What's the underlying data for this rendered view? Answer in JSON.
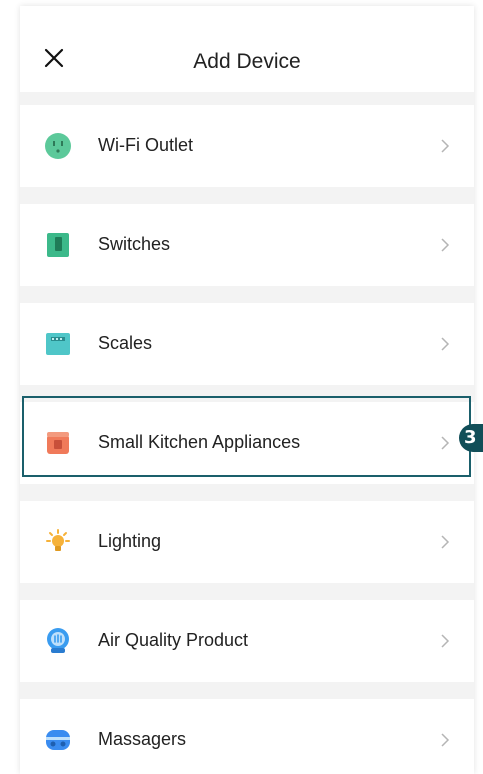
{
  "header": {
    "title": "Add Device"
  },
  "devices": [
    {
      "label": "Wi-Fi Outlet",
      "icon": "outlet-icon",
      "color": "#5cc99a"
    },
    {
      "label": "Switches",
      "icon": "switch-icon",
      "color": "#3cb98a"
    },
    {
      "label": "Scales",
      "icon": "scale-icon",
      "color": "#4fc6c8"
    },
    {
      "label": "Small Kitchen Appliances",
      "icon": "kitchen-appliance-icon",
      "color": "#f07a5a"
    },
    {
      "label": "Lighting",
      "icon": "lightbulb-icon",
      "color": "#f6b23a"
    },
    {
      "label": "Air Quality Product",
      "icon": "air-purifier-icon",
      "color": "#3a9cf0"
    },
    {
      "label": "Massagers",
      "icon": "massager-icon",
      "color": "#3a8cf0"
    }
  ],
  "annotation": {
    "step_number": "3",
    "highlighted_item": "Small Kitchen Appliances",
    "color": "#114e58"
  }
}
